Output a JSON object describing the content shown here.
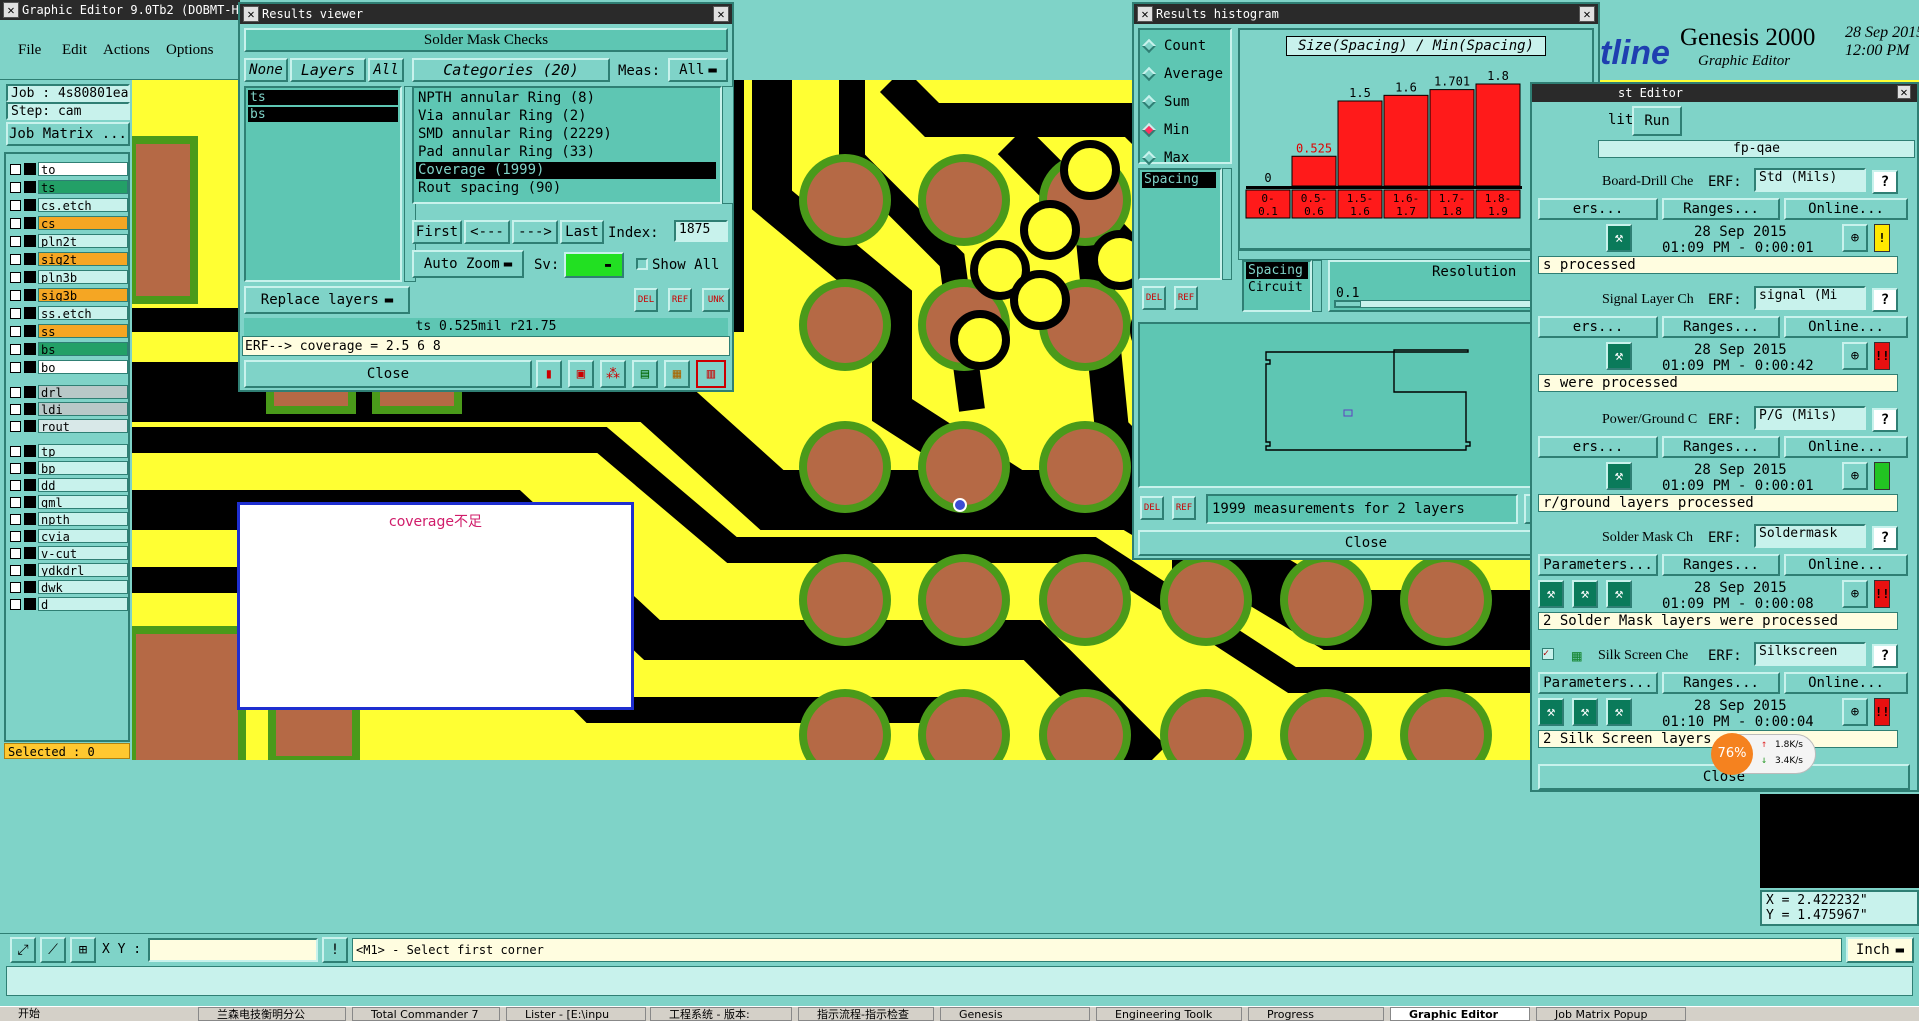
{
  "main": {
    "title": "Graphic Editor 9.0Tb2 (DOBMT-H",
    "menu": [
      "File",
      "Edit",
      "Actions",
      "Options"
    ],
    "job": "Job : 4s80801ea0",
    "step": "Step: cam",
    "job_matrix": "Job Matrix ...",
    "layers": [
      {
        "name": "to",
        "color": "#ffffff"
      },
      {
        "name": "ts",
        "color": "#23a067"
      },
      {
        "name": "cs.etch",
        "color": "#c8f2ec"
      },
      {
        "name": "cs",
        "color": "#f5a623"
      },
      {
        "name": "pln2t",
        "color": "#c8f2ec"
      },
      {
        "name": "sig2t",
        "color": "#f5a623"
      },
      {
        "name": "pln3b",
        "color": "#c8f2ec"
      },
      {
        "name": "sig3b",
        "color": "#f5a623"
      },
      {
        "name": "ss.etch",
        "color": "#c8f2ec"
      },
      {
        "name": "ss",
        "color": "#f5a623"
      },
      {
        "name": "bs",
        "color": "#23a067"
      },
      {
        "name": "bo",
        "color": "#ffffff"
      },
      {
        "name": "drl",
        "color": "#b8c8c8"
      },
      {
        "name": "ldi",
        "color": "#b8c8c8"
      },
      {
        "name": "rout",
        "color": "#d8e8e8"
      },
      {
        "name": "tp",
        "color": "#c8f2ec"
      },
      {
        "name": "bp",
        "color": "#c8f2ec"
      },
      {
        "name": "dd",
        "color": "#c8f2ec"
      },
      {
        "name": "gml",
        "color": "#c8f2ec"
      },
      {
        "name": "npth",
        "color": "#c8f2ec"
      },
      {
        "name": "cvia",
        "color": "#c8f2ec"
      },
      {
        "name": "v-cut",
        "color": "#c8f2ec"
      },
      {
        "name": "ydkdrl",
        "color": "#c8f2ec"
      },
      {
        "name": "dwk",
        "color": "#c8f2ec"
      },
      {
        "name": "d",
        "color": "#c8f2ec"
      }
    ],
    "selected": "Selected : 0",
    "xy_label": "X Y :",
    "prompt": "<M1> - Select first corner",
    "unit": "Inch",
    "coord_x": "X = 2.422232\"",
    "coord_y": "Y = 1.475967\"",
    "annotation": "coverage不足",
    "brand": "tline",
    "product": "Genesis 2000",
    "product_sub": "Graphic Editor",
    "date": "28 Sep 2015",
    "time": "12:00 PM"
  },
  "results_viewer": {
    "title": "Results viewer",
    "header": "Solder Mask Checks",
    "none_btn": "None",
    "layers_btn": "Layers",
    "all_btn": "All",
    "categories_btn": "Categories (20)",
    "meas_label": "Meas:",
    "meas_value": "All",
    "layers": [
      "ts",
      "bs"
    ],
    "categories": [
      "NPTH annular Ring (8)",
      "Via annular Ring (2)",
      "SMD annular Ring (2229)",
      "Pad annular Ring (33)",
      "Coverage (1999)",
      "Rout spacing (90)"
    ],
    "first": "First",
    "prev": "<---",
    "next": "--->",
    "last": "Last",
    "index_label": "Index:",
    "index_value": "1875",
    "auto_zoom": "Auto Zoom",
    "sv_label": "Sv:",
    "show_all": "Show All",
    "replace_layers": "Replace layers",
    "del": "DEL",
    "ref": "REF",
    "unk": "UNK",
    "status": "ts 0.525mil  r21.75",
    "erf": "ERF--> coverage = 2.5 6 8",
    "close": "Close"
  },
  "histogram": {
    "title": "Results histogram",
    "options": [
      "Count",
      "Average",
      "Sum",
      "Min",
      "Max"
    ],
    "selected_option": "Min",
    "chart_title": "Size(Spacing) / Min(Spacing)",
    "list_item": "Spacing",
    "types": [
      "Spacing",
      "Circuit"
    ],
    "resolution_label": "Resolution",
    "resolution_value": "0.1",
    "del": "DEL",
    "ref": "REF",
    "measurements": "1999 measurements for 2 layers",
    "close": "Close"
  },
  "chart_data": {
    "type": "bar",
    "title": "Size(Spacing) / Min(Spacing)",
    "categories": [
      "0-0.1",
      "0.5-0.6",
      "1.5-1.6",
      "1.6-1.7",
      "1.7-1.8",
      "1.8-1.9"
    ],
    "values": [
      0,
      0.525,
      1.5,
      1.6,
      1.701,
      1.8
    ],
    "value_labels": [
      "0",
      "0.525",
      "1.5",
      "1.6",
      "1.701",
      "1.8"
    ],
    "cat_top": [
      "0-",
      "0.5-",
      "1.5-",
      "1.6-",
      "1.7-",
      "1.8-"
    ],
    "cat_bottom": [
      "0.1",
      "0.6",
      "1.6",
      "1.7",
      "1.8",
      "1.9"
    ],
    "colors": {
      "bar": "#ff1a1a",
      "label_red": "#e00000"
    }
  },
  "checklist": {
    "title": "st Editor",
    "menu": [
      "lit",
      "Run"
    ],
    "name": "fp-qae",
    "erf_label": "ERF:",
    "params_label": "Parameters...",
    "ranges_label": "Ranges...",
    "online_label": "Online...",
    "close": "Close",
    "items": [
      {
        "name": "Board-Drill Che",
        "erf": "Std (Mils)",
        "date": "28 Sep 2015",
        "time": "01:09 PM - 0:00:01",
        "params": "ers...",
        "status": "s processed",
        "flag": "!",
        "flag_color": "#ffe800"
      },
      {
        "name": "Signal Layer Ch",
        "erf": "signal (Mi",
        "date": "28 Sep 2015",
        "time": "01:09 PM - 0:00:42",
        "params": "ers...",
        "status": "s were processed",
        "flag": "!!",
        "flag_color": "#e81010"
      },
      {
        "name": "Power/Ground C",
        "erf": "P/G (Mils)",
        "date": "28 Sep 2015",
        "time": "01:09 PM - 0:00:01",
        "params": "ers...",
        "status": "r/ground layers processed",
        "flag": "",
        "flag_color": "#22c422"
      },
      {
        "name": "Solder Mask Ch",
        "erf": "Soldermask",
        "date": "28 Sep 2015",
        "time": "01:09 PM - 0:00:08",
        "params": "Parameters...",
        "status": "2 Solder Mask layers were processed",
        "flag": "!!",
        "flag_color": "#e81010"
      },
      {
        "name": "Silk Screen Che",
        "erf": "Silkscreen",
        "date": "28 Sep 2015",
        "time": "01:10 PM - 0:00:04",
        "params": "Parameters...",
        "status": "2 Silk Screen layers",
        "flag": "!!",
        "flag_color": "#e81010"
      }
    ]
  },
  "net_widget": {
    "percent": "76%",
    "up": "1.8K/s",
    "down": "3.4K/s"
  },
  "taskbar": {
    "start": "开始",
    "items": [
      "兰森电技衡明分公",
      "Total Commander 7",
      "Lister - [E:\\inpu",
      "工程系统 - 版本:",
      "指示流程-指示检查",
      "Genesis",
      "Engineering Toolk",
      "Progress",
      "Graphic Editor",
      "Job Matrix Popup"
    ]
  }
}
